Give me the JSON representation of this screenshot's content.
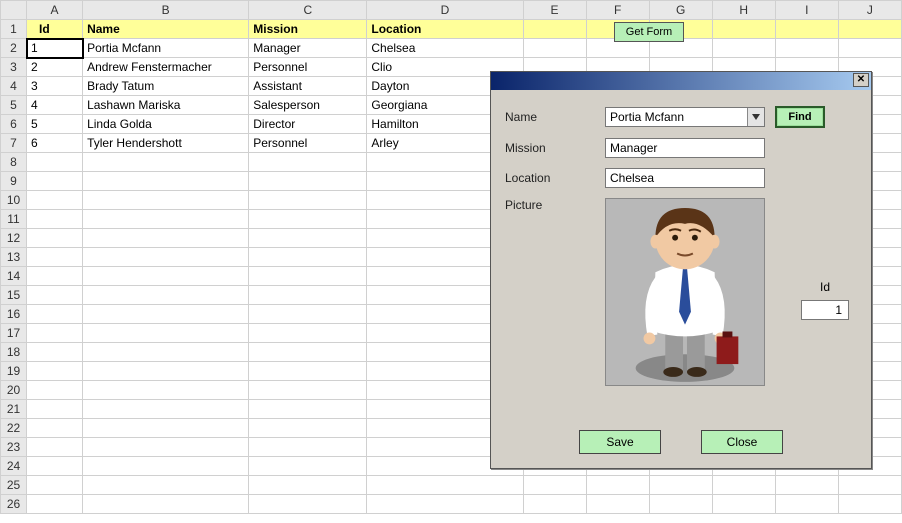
{
  "columns": [
    "A",
    "B",
    "C",
    "D",
    "E",
    "F",
    "G",
    "H",
    "I",
    "J"
  ],
  "row_numbers": [
    1,
    2,
    3,
    4,
    5,
    6,
    7,
    8,
    9,
    10,
    11,
    12,
    13,
    14,
    15,
    16,
    17,
    18,
    19,
    20,
    21,
    22,
    23,
    24,
    25,
    26
  ],
  "headers": {
    "id": "Id",
    "name": "Name",
    "mission": "Mission",
    "location": "Location"
  },
  "rows": [
    {
      "id": 1,
      "name": "Portia Mcfann",
      "mission": "Manager",
      "location": "Chelsea"
    },
    {
      "id": 2,
      "name": "Andrew Fenstermacher",
      "mission": "Personnel",
      "location": "Clio"
    },
    {
      "id": 3,
      "name": "Brady Tatum",
      "mission": "Assistant",
      "location": "Dayton"
    },
    {
      "id": 4,
      "name": "Lashawn Mariska",
      "mission": "Salesperson",
      "location": "Georgiana"
    },
    {
      "id": 5,
      "name": "Linda Golda",
      "mission": "Director",
      "location": "Hamilton"
    },
    {
      "id": 6,
      "name": "Tyler Hendershott",
      "mission": "Personnel",
      "location": "Arley"
    }
  ],
  "selected_row": 2,
  "get_form_label": "Get Form",
  "form": {
    "labels": {
      "name": "Name",
      "mission": "Mission",
      "location": "Location",
      "picture": "Picture",
      "id": "Id"
    },
    "values": {
      "name": "Portia Mcfann",
      "mission": "Manager",
      "location": "Chelsea",
      "id": "1"
    },
    "find_label": "Find",
    "save_label": "Save",
    "close_label": "Close",
    "avatar_colors": {
      "skin": "#f1c9a3",
      "hair": "#5a3417",
      "tie": "#2a4d9b",
      "shirt": "#ffffff",
      "pants": "#9a9a9a",
      "case": "#8e1b1b"
    }
  }
}
